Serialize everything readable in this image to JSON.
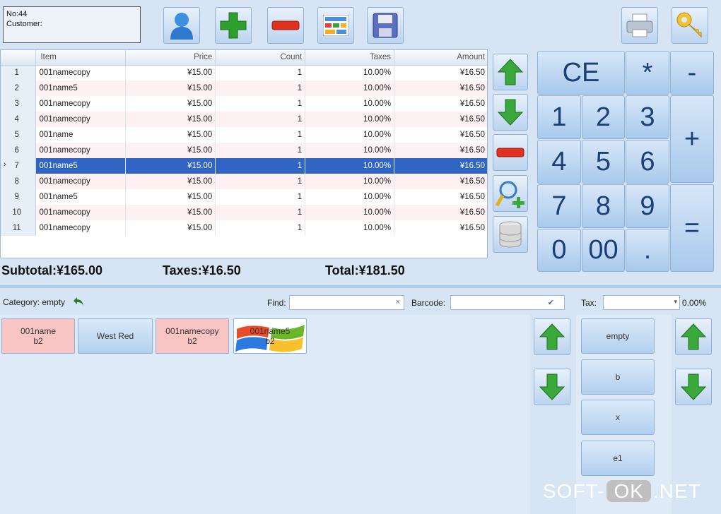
{
  "order": {
    "no": "No:44",
    "customer": "Customer:"
  },
  "grid": {
    "columns": [
      "Item",
      "Price",
      "Count",
      "Taxes",
      "Amount"
    ],
    "rows": [
      {
        "n": "1",
        "item": "001namecopy",
        "price": "¥15.00",
        "count": "1",
        "taxes": "10.00%",
        "amount": "¥16.50"
      },
      {
        "n": "2",
        "item": "001name5",
        "price": "¥15.00",
        "count": "1",
        "taxes": "10.00%",
        "amount": "¥16.50"
      },
      {
        "n": "3",
        "item": "001namecopy",
        "price": "¥15.00",
        "count": "1",
        "taxes": "10.00%",
        "amount": "¥16.50"
      },
      {
        "n": "4",
        "item": "001namecopy",
        "price": "¥15.00",
        "count": "1",
        "taxes": "10.00%",
        "amount": "¥16.50"
      },
      {
        "n": "5",
        "item": "001name",
        "price": "¥15.00",
        "count": "1",
        "taxes": "10.00%",
        "amount": "¥16.50"
      },
      {
        "n": "6",
        "item": "001namecopy",
        "price": "¥15.00",
        "count": "1",
        "taxes": "10.00%",
        "amount": "¥16.50"
      },
      {
        "n": "7",
        "item": "001name5",
        "price": "¥15.00",
        "count": "1",
        "taxes": "10.00%",
        "amount": "¥16.50"
      },
      {
        "n": "8",
        "item": "001namecopy",
        "price": "¥15.00",
        "count": "1",
        "taxes": "10.00%",
        "amount": "¥16.50"
      },
      {
        "n": "9",
        "item": "001name5",
        "price": "¥15.00",
        "count": "1",
        "taxes": "10.00%",
        "amount": "¥16.50"
      },
      {
        "n": "10",
        "item": "001namecopy",
        "price": "¥15.00",
        "count": "1",
        "taxes": "10.00%",
        "amount": "¥16.50"
      },
      {
        "n": "11",
        "item": "001namecopy",
        "price": "¥15.00",
        "count": "1",
        "taxes": "10.00%",
        "amount": "¥16.50"
      }
    ],
    "selected_row": "7",
    "row_pointer": "›"
  },
  "totals": {
    "subtotal": "Subtotal:¥165.00",
    "taxes": "Taxes:¥16.50",
    "total": "Total:¥181.50"
  },
  "keypad": {
    "ce": "CE",
    "mul": "*",
    "minus": "-",
    "plus": "+",
    "equals": "=",
    "dot": ".",
    "double_zero": "00",
    "d0": "0",
    "d1": "1",
    "d2": "2",
    "d3": "3",
    "d4": "4",
    "d5": "5",
    "d6": "6",
    "d7": "7",
    "d8": "8",
    "d9": "9"
  },
  "filters": {
    "category": "Category: empty",
    "find_label": "Find:",
    "find_value": "",
    "find_clear": "×",
    "barcode_label": "Barcode:",
    "barcode_value": "",
    "barcode_check": "✔",
    "tax_label": "Tax:",
    "tax_value": "",
    "tax_caret": "▾",
    "tax_percent": "0.00%"
  },
  "products": [
    {
      "line1": "001name",
      "line2": "b2"
    },
    {
      "line1": "West Red",
      "line2": ""
    },
    {
      "line1": "001namecopy",
      "line2": "b2"
    },
    {
      "line1": "001name5",
      "line2": "b2"
    }
  ],
  "categories": [
    "empty",
    "b",
    "x",
    "e1"
  ],
  "watermark": {
    "a": "SOFT-",
    "b": "OK",
    "c": ".NET"
  },
  "colors": {
    "selected_row": "#3165c4",
    "pink_product": "#f8c4c4",
    "accent_green": "#2e9e2e",
    "minus_red": "#e03020"
  }
}
